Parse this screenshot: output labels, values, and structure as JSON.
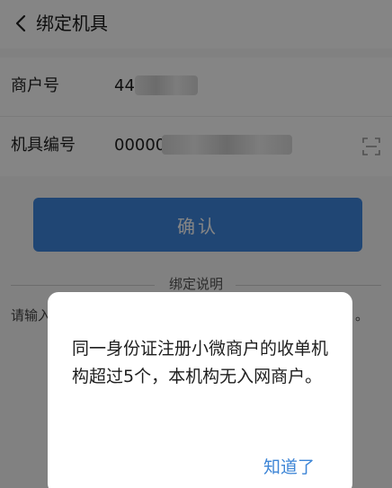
{
  "header": {
    "title": "绑定机具",
    "back_icon": "chevron-left-icon"
  },
  "form": {
    "merchant_label": "商户号",
    "merchant_value": "44",
    "device_label": "机具编号",
    "device_value": "00000",
    "scan_icon": "scan-icon"
  },
  "confirm_button": "确认",
  "binding_section": {
    "title": "绑定说明",
    "instruction_start": "请输入",
    "instruction_end": "。"
  },
  "dialog": {
    "message": "同一身份证注册小微商户的收单机构超过5个，本机构无入网商户。",
    "ok_label": "知道了"
  },
  "colors": {
    "accent": "#3f86de",
    "link": "#3d85d6",
    "overlay": "rgba(0,0,0,0.48)"
  }
}
